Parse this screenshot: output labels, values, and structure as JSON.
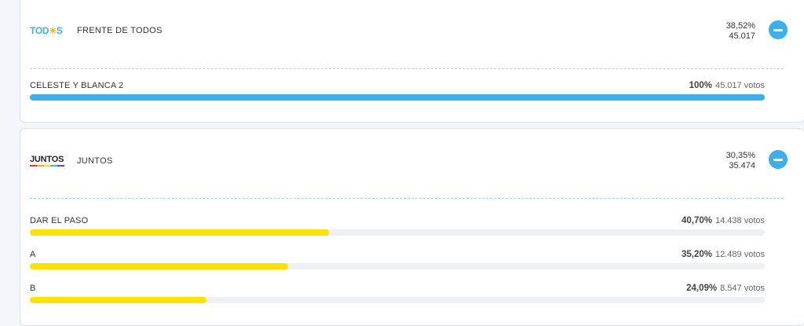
{
  "cards": [
    {
      "logo_text": "TOD",
      "logo_tail": "S",
      "logo_sun": "☀",
      "party": "FRENTE DE TODOS",
      "percent": "38,52%",
      "votes": "45.017",
      "lists": [
        {
          "name": "CELESTE Y BLANCA 2",
          "percent": "100%",
          "votes": "45.017 votos",
          "share": 1.0,
          "color": "#3bb0ea"
        }
      ]
    },
    {
      "logo_text": "JUNTOS",
      "party": "JUNTOS",
      "percent": "30,35%",
      "votes": "35.474",
      "lists": [
        {
          "name": "DAR EL PASO",
          "percent": "40,70%",
          "votes": "14.438 votos",
          "share": 0.407,
          "color": "#ffe100"
        },
        {
          "name": "A",
          "percent": "35,20%",
          "votes": "12.489 votos",
          "share": 0.352,
          "color": "#ffe100"
        },
        {
          "name": "B",
          "percent": "24,09%",
          "votes": "8.547 votos",
          "share": 0.2409,
          "color": "#ffe100"
        }
      ]
    }
  ],
  "colors": {
    "accent": "#3bb0ea",
    "juntos_bar": "#ffe100",
    "juntos_stripe": [
      "#e63a2e",
      "#f5a623",
      "#ffe100",
      "#3bb0ea",
      "#7b3fa0"
    ]
  }
}
